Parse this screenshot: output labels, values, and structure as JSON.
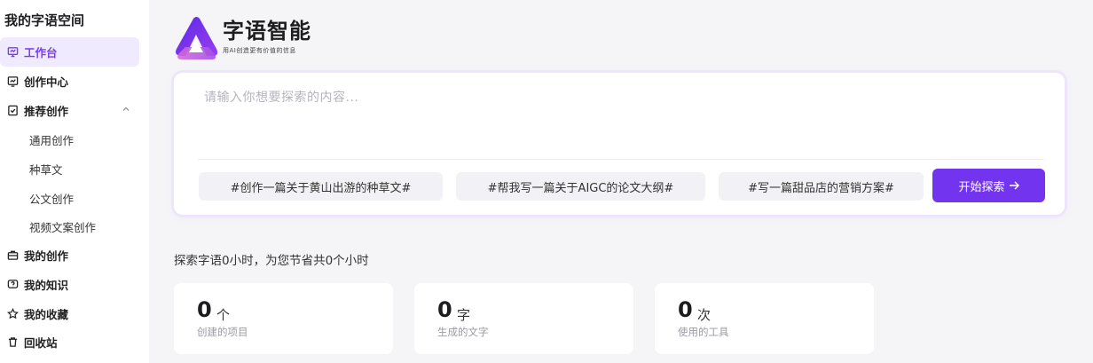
{
  "sidebar": {
    "title": "我的字语空间",
    "items": [
      {
        "label": "工作台",
        "icon": "monitor-icon",
        "active": true
      },
      {
        "label": "创作中心",
        "icon": "chart-board-icon"
      },
      {
        "label": "推荐创作",
        "icon": "document-check-icon",
        "expanded": true
      },
      {
        "label": "我的创作",
        "icon": "briefcase-icon"
      },
      {
        "label": "我的知识",
        "icon": "knowledge-icon"
      },
      {
        "label": "我的收藏",
        "icon": "star-icon"
      },
      {
        "label": "回收站",
        "icon": "trash-icon"
      }
    ],
    "sub_items": [
      {
        "label": "通用创作"
      },
      {
        "label": "种草文"
      },
      {
        "label": "公文创作"
      },
      {
        "label": "视频文案创作"
      }
    ]
  },
  "brand": {
    "name": "字语智能",
    "slogan": "用AI创造更有价值的信息",
    "accent_color": "#7334f0"
  },
  "search": {
    "placeholder": "请输入你想要探索的内容...",
    "value": "",
    "suggestions": [
      "#创作一篇关于黄山出游的种草文#",
      "#帮我写一篇关于AIGC的论文大纲#",
      "#写一篇甜品店的营销方案#"
    ],
    "button_label": "开始探索"
  },
  "stats": {
    "summary": "探索字语0小时，为您节省共0个小时",
    "cards": [
      {
        "value": "0",
        "unit": "个",
        "label": "创建的项目"
      },
      {
        "value": "0",
        "unit": "字",
        "label": "生成的文字"
      },
      {
        "value": "0",
        "unit": "次",
        "label": "使用的工具"
      }
    ]
  }
}
